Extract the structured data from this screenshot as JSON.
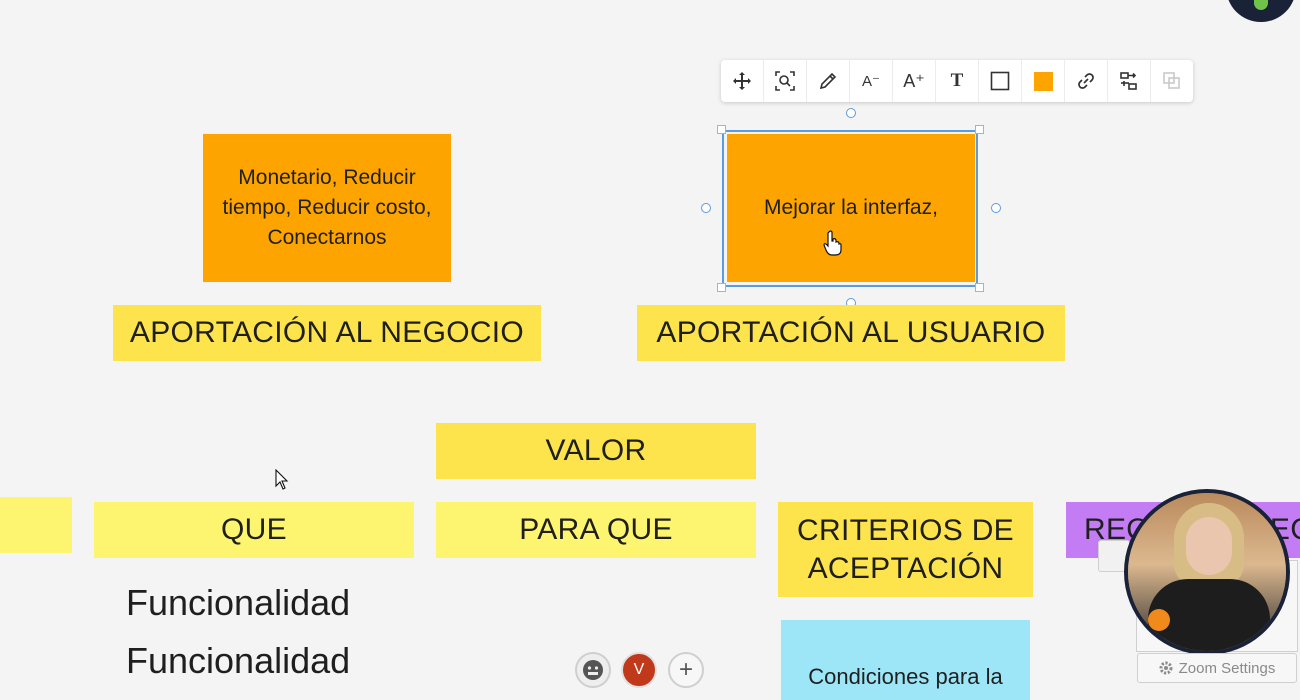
{
  "toolbar": {
    "buttons": [
      {
        "name": "move-icon"
      },
      {
        "name": "zoom-to-fit-icon"
      },
      {
        "name": "pencil-icon"
      },
      {
        "name": "decrease-font-icon",
        "label": "A⁻"
      },
      {
        "name": "increase-font-icon",
        "label": "A⁺"
      },
      {
        "name": "text-format-icon",
        "label": "T"
      },
      {
        "name": "border-icon"
      },
      {
        "name": "fill-color-swatch"
      },
      {
        "name": "link-icon"
      },
      {
        "name": "align-icon"
      },
      {
        "name": "duplicate-icon"
      }
    ],
    "fill_color": "#fda400"
  },
  "board": {
    "orange_note_business": "Monetario, Reducir tiempo, Reducir costo, Conectarnos",
    "orange_note_user": "Mejorar la interfaz,",
    "label_business": "APORTACIÓN AL NEGOCIO",
    "label_user": "APORTACIÓN AL USUARIO",
    "label_valor": "VALOR",
    "label_que": "QUE",
    "label_para_que": "PARA QUE",
    "label_criterios": "CRITERIOS DE ACEPTACIÓN",
    "label_purple_partial": "REQ",
    "label_purple_partial_2": "EC",
    "text_funcionalidad_1": "Funcionalidad",
    "text_funcionalidad_2": "Funcionalidad",
    "cyan_note_partial": "Condiciones para la"
  },
  "collaborators": {
    "avatar_v": "V",
    "add_label": "+"
  },
  "zoom": {
    "settings_label": "Zoom Settings"
  },
  "colors": {
    "yellow": "#fde44c",
    "orange": "#fda400",
    "violet": "#c47cf5",
    "cyan": "#9ce6f7",
    "selection": "#5b9be0"
  }
}
